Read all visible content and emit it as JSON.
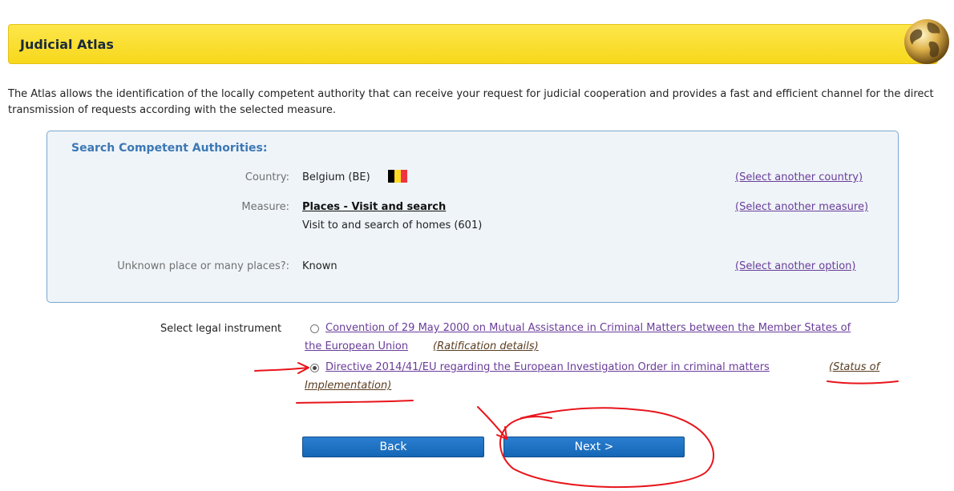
{
  "header": {
    "title": "Judicial Atlas"
  },
  "intro": "The Atlas allows the identification of the locally competent authority that can receive your request for judicial cooperation and provides a fast and efficient channel for the direct transmission of requests according with the selected measure.",
  "search": {
    "title": "Search Competent Authorities:",
    "country_label": "Country:",
    "country_value": "Belgium (BE)",
    "country_flag_colors": [
      "#000000",
      "#fdda24",
      "#ef3340"
    ],
    "country_link": "(Select another country)",
    "measure_label": "Measure:",
    "measure_value": "Places - Visit and search",
    "measure_sub": "Visit to and search of homes (601)",
    "measure_link": "(Select another measure)",
    "place_label": "Unknown place or many places?:",
    "place_value": "Known",
    "place_link": "(Select another option)"
  },
  "legal": {
    "label": "Select legal instrument",
    "options": [
      {
        "line1": "Convention of 29 May 2000 on Mutual Assistance in Criminal Matters between the Member States of",
        "line2": "the European Union",
        "extra": "(Ratification details)",
        "selected": false
      },
      {
        "line1": "Directive 2014/41/EU regarding the European Investigation Order in criminal matters",
        "extra1": "(Status of",
        "extra2": "Implementation)",
        "selected": true
      }
    ]
  },
  "buttons": {
    "back": "Back",
    "next": "Next >"
  },
  "colors": {
    "header": "#f7d81c",
    "button": "#1a73c4",
    "link": "#6a3d9a",
    "annotation": "#e8141b"
  }
}
